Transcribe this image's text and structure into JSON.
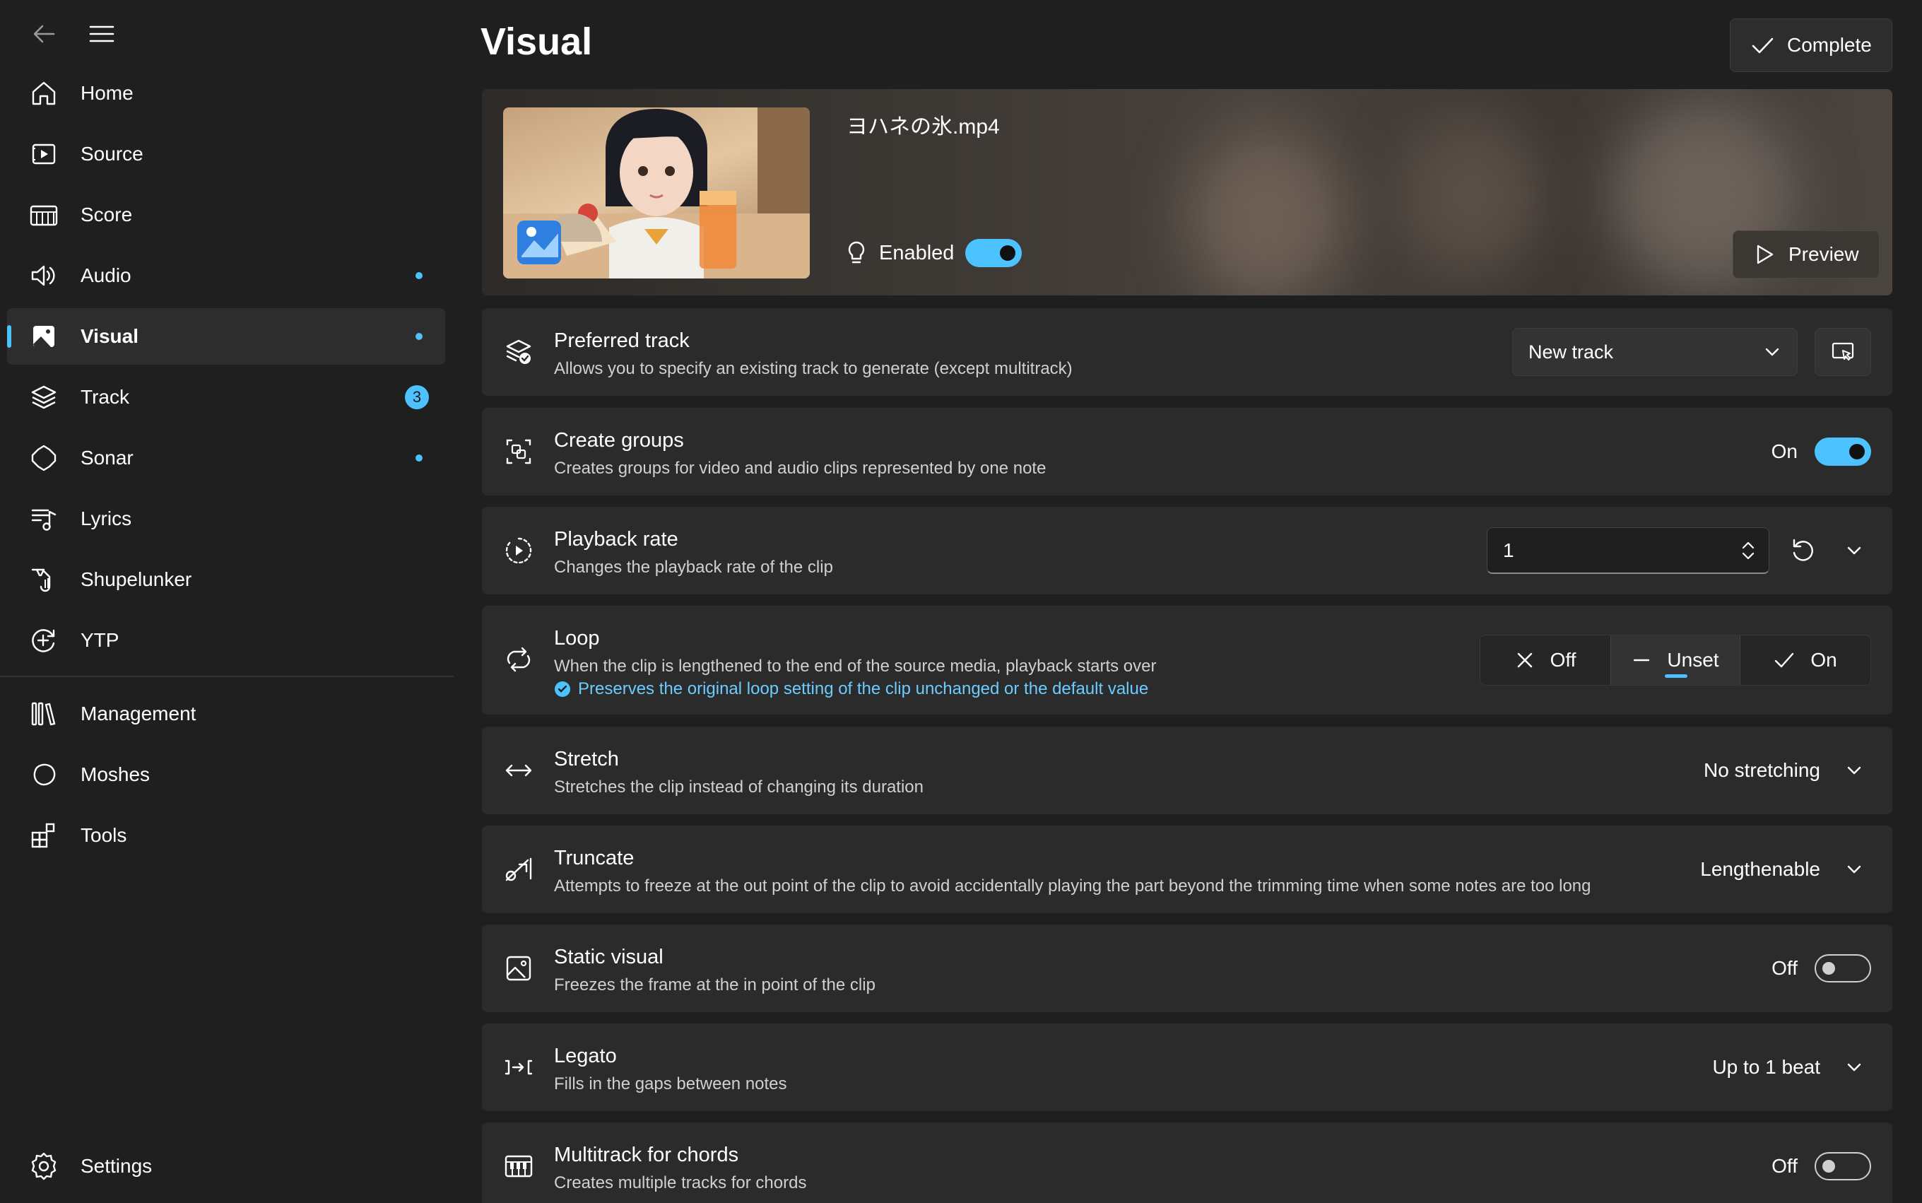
{
  "sidebar": {
    "items": [
      {
        "label": "Home"
      },
      {
        "label": "Source"
      },
      {
        "label": "Score"
      },
      {
        "label": "Audio"
      },
      {
        "label": "Visual"
      },
      {
        "label": "Track",
        "badge": "3"
      },
      {
        "label": "Sonar"
      },
      {
        "label": "Lyrics"
      },
      {
        "label": "Shupelunker"
      },
      {
        "label": "YTP"
      },
      {
        "label": "Management"
      },
      {
        "label": "Moshes"
      },
      {
        "label": "Tools"
      }
    ],
    "settings_label": "Settings"
  },
  "header": {
    "title": "Visual",
    "complete_label": "Complete"
  },
  "hero": {
    "file_name": "ヨハネの氷.mp4",
    "enabled_label": "Enabled",
    "enabled": true,
    "preview_label": "Preview"
  },
  "settings": {
    "preferred_track": {
      "title": "Preferred track",
      "description": "Allows you to specify an existing track to generate (except multitrack)",
      "value": "New track"
    },
    "create_groups": {
      "title": "Create groups",
      "description": "Creates groups for video and audio clips represented by one note",
      "state_label": "On",
      "on": true
    },
    "playback_rate": {
      "title": "Playback rate",
      "description": "Changes the playback rate of the clip",
      "value": "1"
    },
    "loop": {
      "title": "Loop",
      "description": "When the clip is lengthened to the end of the source media, playback starts over",
      "note": "Preserves the original loop setting of the clip unchanged or the default value",
      "options": [
        "Off",
        "Unset",
        "On"
      ],
      "selected": "Unset"
    },
    "stretch": {
      "title": "Stretch",
      "description": "Stretches the clip instead of changing its duration",
      "value": "No stretching"
    },
    "truncate": {
      "title": "Truncate",
      "description": "Attempts to freeze at the out point of the clip to avoid accidentally playing the part beyond the trimming time when some notes are too long",
      "value": "Lengthenable"
    },
    "static_visual": {
      "title": "Static visual",
      "description": "Freezes the frame at the in point of the clip",
      "state_label": "Off",
      "on": false
    },
    "legato": {
      "title": "Legato",
      "description": "Fills in the gaps between notes",
      "value": "Up to 1 beat"
    },
    "multitrack": {
      "title": "Multitrack for chords",
      "description": "Creates multiple tracks for chords",
      "state_label": "Off",
      "on": false
    }
  },
  "colors": {
    "accent": "#4cc2ff",
    "background": "#1f1f1f",
    "card": "#2b2b2b"
  }
}
